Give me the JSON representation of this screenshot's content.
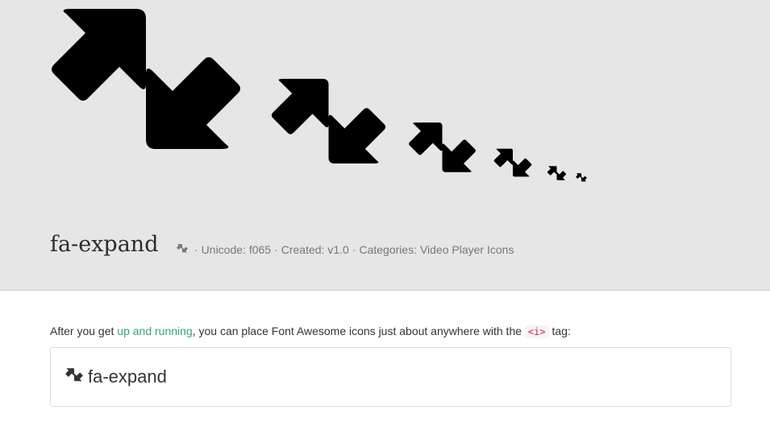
{
  "icon": {
    "name": "fa-expand",
    "glyph": "expand-icon",
    "preview_sizes": [
      "5x",
      "4x",
      "3x",
      "2x",
      "lg",
      "base"
    ]
  },
  "meta": {
    "unicode_label": "Unicode: f065",
    "created_label": "Created: v1.0",
    "categories_label": "Categories: Video Player Icons",
    "separator": "·"
  },
  "intro": {
    "before_link": "After you get ",
    "link_text": "up and running",
    "after_link": ", you can place Font Awesome icons just about anywhere with the ",
    "tag": "<i>",
    "after_tag": " tag:"
  },
  "example": {
    "label": "fa-expand"
  },
  "colors": {
    "hero_bg": "#e6e6e6",
    "icon_fill": "#222222",
    "link": "#33a57b",
    "code_text": "#c7254e"
  }
}
